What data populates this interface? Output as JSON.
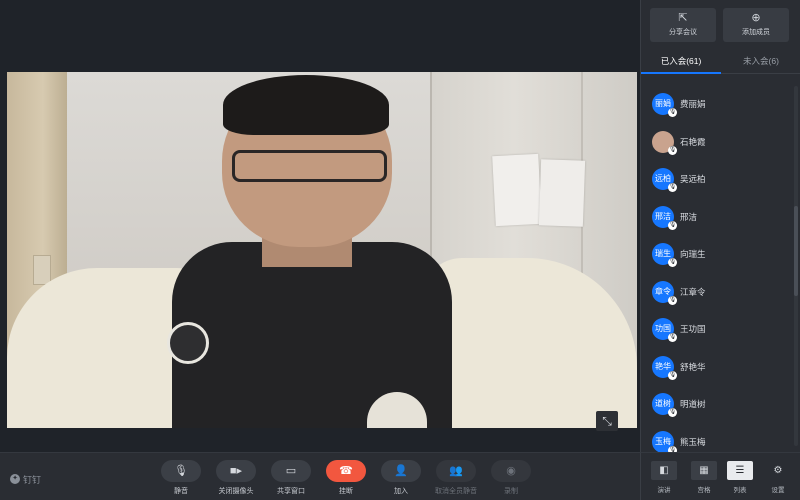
{
  "top_actions": {
    "share": {
      "icon": "share-icon",
      "label": "分享会议"
    },
    "add": {
      "icon": "add-member-icon",
      "label": "添加成员"
    }
  },
  "tabs": [
    {
      "label": "已入会(61)",
      "active": true
    },
    {
      "label": "未入会(6)",
      "active": false
    }
  ],
  "participants": [
    {
      "avatar": "丽娟",
      "name": "费丽娟"
    },
    {
      "avatar": "",
      "name": "石艳霞",
      "photo": true
    },
    {
      "avatar": "远柏",
      "name": "吴远柏"
    },
    {
      "avatar": "邢洁",
      "name": "邢洁"
    },
    {
      "avatar": "瑞生",
      "name": "向瑞生"
    },
    {
      "avatar": "章令",
      "name": "江章令"
    },
    {
      "avatar": "功国",
      "name": "王功国"
    },
    {
      "avatar": "艳华",
      "name": "舒艳华"
    },
    {
      "avatar": "道树",
      "name": "明道树"
    },
    {
      "avatar": "玉梅",
      "name": "熊玉梅"
    }
  ],
  "toolbar": {
    "brand": "钉钉",
    "mute": {
      "icon": "microphone-icon",
      "label": "静音"
    },
    "camera": {
      "icon": "camera-icon",
      "label": "关闭摄像头"
    },
    "share_window": {
      "icon": "share-screen-icon",
      "label": "共享窗口"
    },
    "hangup": {
      "icon": "hangup-icon",
      "label": "挂断"
    },
    "join": {
      "icon": "join-icon",
      "label": "加入"
    },
    "unmute_all": {
      "icon": "group-mute-icon",
      "label": "取消全员静音"
    },
    "record": {
      "icon": "record-icon",
      "label": "录制"
    }
  },
  "view_controls": {
    "speaker": {
      "icon": "speaker-view-icon",
      "label": "演讲"
    },
    "gallery": {
      "icon": "gallery-view-icon",
      "label": "宫格"
    },
    "list": {
      "icon": "list-view-icon",
      "label": "列表"
    },
    "settings": {
      "icon": "settings-icon",
      "label": "设置"
    }
  },
  "colors": {
    "background": "#1f2329",
    "panel": "#2a2d33",
    "accent": "#1677ff",
    "hangup": "#f2573f"
  }
}
